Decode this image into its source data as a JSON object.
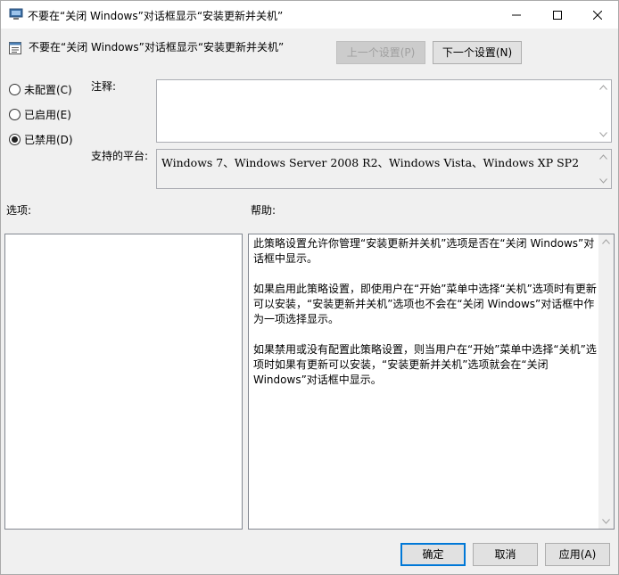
{
  "window": {
    "title": "不要在“关闭 Windows”对话框显示“安装更新并关机”"
  },
  "header": {
    "policy_title": "不要在“关闭 Windows”对话框显示“安装更新并关机”",
    "prev_label": "上一个设置(P)",
    "next_label": "下一个设置(N)"
  },
  "state": {
    "options": [
      {
        "label": "未配置(C)",
        "selected": false
      },
      {
        "label": "已启用(E)",
        "selected": false
      },
      {
        "label": "已禁用(D)",
        "selected": true
      }
    ]
  },
  "fields": {
    "comment_label": "注释:",
    "comment_value": "",
    "platform_label": "支持的平台:",
    "platform_value": "Windows 7、Windows Server 2008 R2、Windows Vista、Windows XP SP2"
  },
  "panels": {
    "options_label": "选项:",
    "help_label": "帮助:",
    "help_paragraphs": [
      "此策略设置允许你管理“安装更新并关机”选项是否在“关闭 Windows”对话框中显示。",
      "如果启用此策略设置，即使用户在“开始”菜单中选择“关机”选项时有更新可以安装，“安装更新并关机”选项也不会在“关闭 Windows”对话框中作为一项选择显示。",
      "如果禁用或没有配置此策略设置，则当用户在“开始”菜单中选择“关机”选项时如果有更新可以安装，“安装更新并关机”选项就会在“关闭 Windows”对话框中显示。"
    ]
  },
  "footer": {
    "ok_label": "确定",
    "cancel_label": "取消",
    "apply_label": "应用(A)"
  }
}
